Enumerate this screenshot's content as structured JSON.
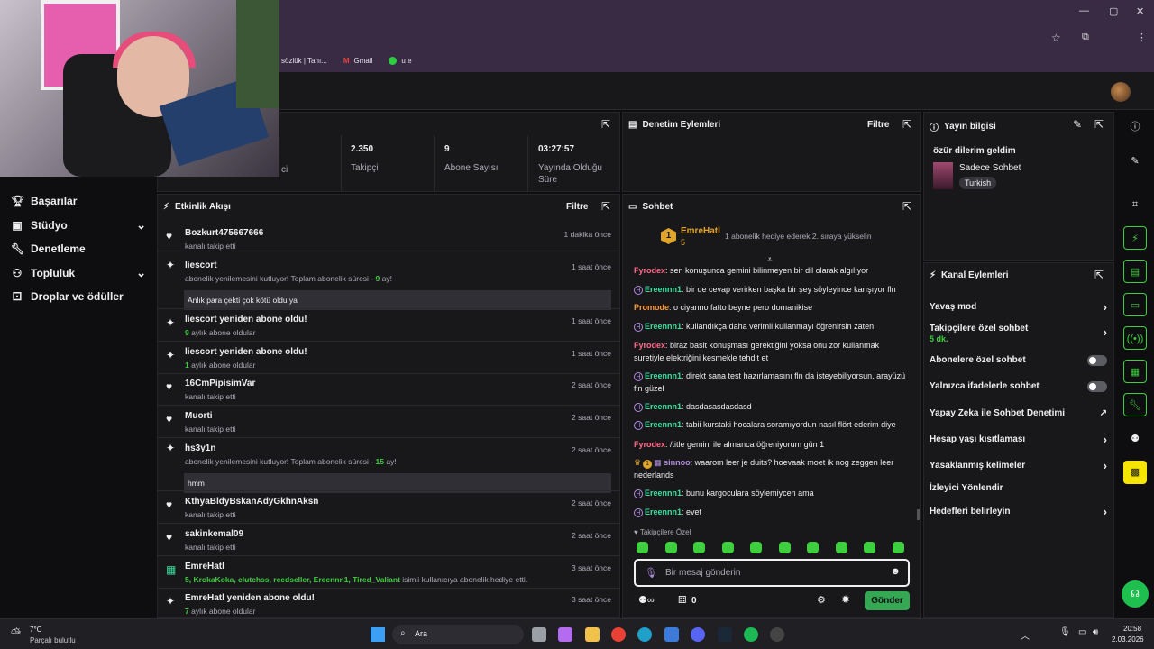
{
  "browser": {
    "bookmarks": [
      "sözlük | Tanı...",
      "Gmail",
      "u e"
    ]
  },
  "stats": [
    {
      "value": "2.350",
      "label": "Takipçi"
    },
    {
      "value": "9",
      "label": "Abone Sayısı"
    },
    {
      "value": "03:27:57",
      "label": "Yayında Olduğu Süre"
    }
  ],
  "stat_partial_label": "ci",
  "sidebar": {
    "items": [
      {
        "label": "Başarılar",
        "icon": "trophy-icon"
      },
      {
        "label": "Stüdyo",
        "icon": "studio-icon"
      },
      {
        "label": "Denetleme",
        "icon": "wrench-icon"
      },
      {
        "label": "Topluluk",
        "icon": "community-icon"
      },
      {
        "label": "Droplar ve ödüller",
        "icon": "gift-icon"
      }
    ]
  },
  "panels": {
    "denetim": "Denetim Eylemleri",
    "filtre": "Filtre",
    "etkinlik": "Etkinlik Akışı",
    "sohbet": "Sohbet",
    "yayin": "Yayın bilgisi",
    "kanal": "Kanal Eylemleri"
  },
  "events": [
    {
      "icon": "heart-icon",
      "name": "Bozkurt475667666",
      "sub": "kanalı takip etti",
      "time": "1 dakika önce"
    },
    {
      "icon": "sparkle-icon",
      "name": "liescort",
      "sub": "abonelik yenilemesini kutluyor! Toplam abonelik süresi - ",
      "subval": "9",
      "subend": " ay!",
      "time": "1 saat önce",
      "msg": "Anlık para çekti çok kötü oldu ya"
    },
    {
      "icon": "sparkle-icon",
      "name": "liescort yeniden abone oldu!",
      "subval": "9",
      "sub": " aylık abone oldular",
      "time": "1 saat önce"
    },
    {
      "icon": "sparkle-icon",
      "name": "liescort yeniden abone oldu!",
      "subval": "1",
      "sub": " aylık abone oldular",
      "time": "1 saat önce"
    },
    {
      "icon": "heart-icon",
      "name": "16CmPipisimVar",
      "sub": "kanalı takip etti",
      "time": "2 saat önce"
    },
    {
      "icon": "heart-icon",
      "name": "Muorti",
      "sub": "kanalı takip etti",
      "time": "2 saat önce"
    },
    {
      "icon": "sparkle-icon",
      "name": "hs3y1n",
      "sub": "abonelik yenilemesini kutluyor! Toplam abonelik süresi - ",
      "subval": "15",
      "subend": " ay!",
      "time": "2 saat önce",
      "msg": "hmm"
    },
    {
      "icon": "heart-icon",
      "name": "KthyaBldyBskanAdyGkhnAksn",
      "sub": "kanalı takip etti",
      "time": "2 saat önce"
    },
    {
      "icon": "heart-icon",
      "name": "sakinkemal09",
      "sub": "kanalı takip etti",
      "time": "2 saat önce"
    },
    {
      "icon": "gift-icon",
      "name": "EmreHatl",
      "subval": "5, KrokaKoka, clutchss, reedseller, Ereennn1, Tired_Valiant",
      "sub": " isimli kullanıcıya abonelik hediye etti.",
      "time": "3 saat önce"
    },
    {
      "icon": "sparkle-icon",
      "name": "EmreHatl yeniden abone oldu!",
      "subval": "7",
      "sub": " aylık abone oldular",
      "time": "3 saat önce"
    }
  ],
  "pinned": {
    "rank": "1",
    "user": "EmreHatl",
    "count": "5",
    "text": "1 abonelik hediye ederek 2. sıraya yükselin"
  },
  "chat": [
    {
      "user": "Fyrodex",
      "color": "#ff6b8a",
      "badge": "",
      "text": "sen konuşunca gemini bilinmeyen bir dil olarak algılıyor"
    },
    {
      "user": "Ereennn1",
      "color": "#3ee0a0",
      "badge": "H",
      "text": "bir de cevap verirken başka bir şey söyleyince karışıyor fln"
    },
    {
      "user": "Promode",
      "color": "#ff9a3c",
      "badge": "",
      "text": "o ciyanno fatto beyne pero domanikise"
    },
    {
      "user": "Ereennn1",
      "color": "#3ee0a0",
      "badge": "H",
      "text": "kullandıkça daha verimli kullanmayı öğrenirsin zaten"
    },
    {
      "user": "Fyrodex",
      "color": "#ff6b8a",
      "badge": "",
      "text": "biraz basit konuşması gerektiğini yoksa onu zor kullanmak suretiyle elektriğini kesmekle tehdit et"
    },
    {
      "user": "Ereennn1",
      "color": "#3ee0a0",
      "badge": "H",
      "text": "direkt sana test hazırlamasını fln da isteyebiliyorsun. arayüzü fln güzel"
    },
    {
      "user": "Ereennn1",
      "color": "#3ee0a0",
      "badge": "H",
      "text": "dasdasasdasdasd"
    },
    {
      "user": "Ereennn1",
      "color": "#3ee0a0",
      "badge": "H",
      "text": "tabii kurstaki hocalara soramıyordun nasıl flört ederim diye"
    },
    {
      "user": "Fyrodex",
      "color": "#ff6b8a",
      "badge": "",
      "text": "/title gemini ile almanca öğreniyorum gün 1"
    },
    {
      "user": "sinnoo",
      "color": "#b18ee0",
      "badge": "crown",
      "text": "waarom leer je duits? hoevaak moet ik nog zeggen leer nederlands"
    },
    {
      "user": "Ereennn1",
      "color": "#3ee0a0",
      "badge": "H",
      "text": "bunu kargoculara söylemiycen ama"
    },
    {
      "user": "Ereennn1",
      "color": "#3ee0a0",
      "badge": "H",
      "text": "evet"
    }
  ],
  "emote_label": "Takipçilere Özel",
  "chat_placeholder": "Bir mesaj gönderin",
  "points": "0",
  "send": "Gönder",
  "stream": {
    "title": "özür dilerim geldim",
    "category": "Sadece Sohbet",
    "tag": "Turkish"
  },
  "kanal": [
    {
      "label": "Yavaş mod",
      "type": "chev"
    },
    {
      "label": "Takipçilere özel sohbet",
      "sub": "5 dk.",
      "type": "chev"
    },
    {
      "label": "Abonelere özel sohbet",
      "type": "toggle"
    },
    {
      "label": "Yalnızca ifadelerle sohbet",
      "type": "toggle"
    },
    {
      "label": "Yapay Zeka ile Sohbet Denetimi",
      "type": "ext"
    },
    {
      "label": "Hesap yaşı kısıtlaması",
      "type": "chev"
    },
    {
      "label": "Yasaklanmış kelimeler",
      "type": "chev"
    },
    {
      "label": "İzleyici Yönlendir",
      "type": "none"
    },
    {
      "label": "Hedefleri belirleyin",
      "type": "chev"
    }
  ],
  "taskbar": {
    "weather_temp": "7°C",
    "weather_desc": "Parçalı bulutlu",
    "search": "Ara",
    "time": "20:58",
    "date": "2.03.2026"
  }
}
